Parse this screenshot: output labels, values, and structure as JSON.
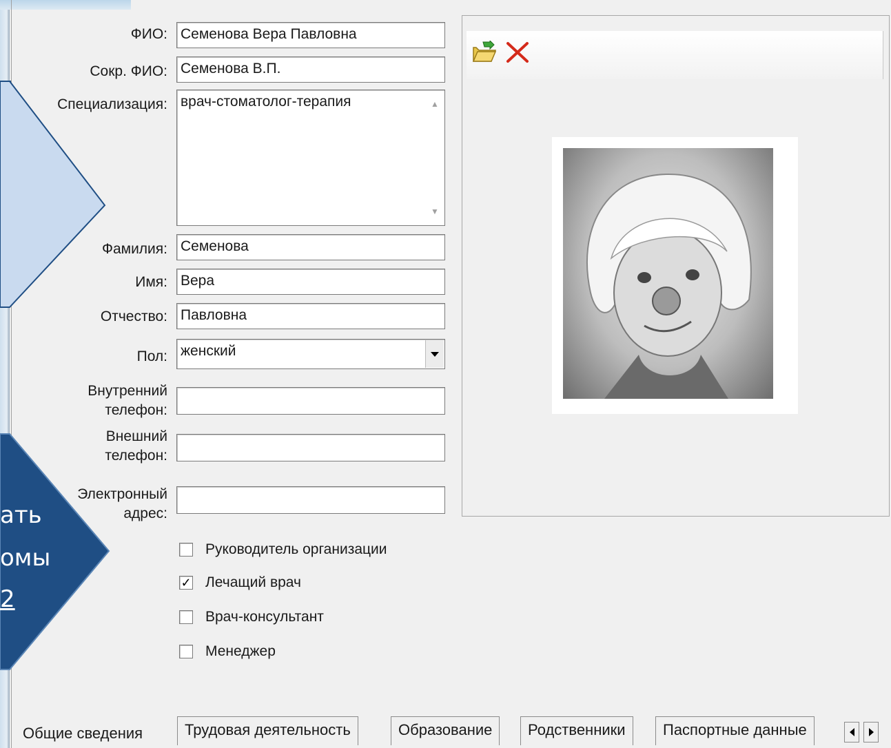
{
  "form": {
    "fio_label": "ФИО:",
    "fio_value": "Семенова Вера Павловна",
    "short_fio_label": "Сокр. ФИО:",
    "short_fio_value": "Семенова В.П.",
    "specialization_label": "Специализация:",
    "specialization_value": "врач-стоматолог-терапия",
    "surname_label": "Фамилия:",
    "surname_value": "Семенова",
    "name_label": "Имя:",
    "name_value": "Вера",
    "patronymic_label": "Отчество:",
    "patronymic_value": "Павловна",
    "gender_label": "Пол:",
    "gender_value": "женский",
    "internal_phone_label_1": "Внутренний",
    "internal_phone_label_2": "телефон:",
    "internal_phone_value": "",
    "external_phone_label_1": "Внешний",
    "external_phone_label_2": "телефон:",
    "external_phone_value": "",
    "email_label_1": "Электронный",
    "email_label_2": "адрес:",
    "email_value": ""
  },
  "checkboxes": [
    {
      "label": "Руководитель организации",
      "checked": false
    },
    {
      "label": "Лечащий врач",
      "checked": true
    },
    {
      "label": "Врач-консультант",
      "checked": false
    },
    {
      "label": "Менеджер",
      "checked": false
    }
  ],
  "check_mark": "✓",
  "photo": {
    "open_icon": "folder-open-icon",
    "delete_icon": "delete-x-icon"
  },
  "tabs": [
    {
      "label": "Общие сведения"
    },
    {
      "label": "Трудовая деятельность"
    },
    {
      "label": "Образование"
    },
    {
      "label": "Родственники"
    },
    {
      "label": "Паспортные данные"
    }
  ],
  "slide": {
    "arrow_text_line1": "ать",
    "arrow_text_line2": "омы",
    "arrow_text_line3": "2"
  },
  "colors": {
    "light_arrow": "#c9daef",
    "dark_arrow": "#1f4e84",
    "delete_red": "#d42a1a"
  }
}
